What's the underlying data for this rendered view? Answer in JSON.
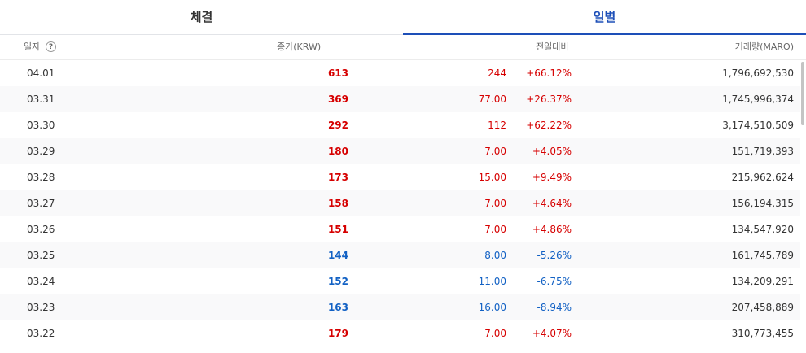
{
  "tabs": [
    {
      "label": "체결"
    },
    {
      "label": "일별"
    }
  ],
  "header": {
    "date": "일자",
    "help": "?",
    "close": "종가(KRW)",
    "change": "전일대비",
    "volume": "거래량(MARO)"
  },
  "colors": {
    "up": "#d60000",
    "down": "#1261c4",
    "accent": "#1d4fb8"
  },
  "rows": [
    {
      "date": "04.01",
      "close": "613",
      "change": "244",
      "pct": "+66.12%",
      "volume": "1,796,692,530",
      "dir": "up"
    },
    {
      "date": "03.31",
      "close": "369",
      "change": "77.00",
      "pct": "+26.37%",
      "volume": "1,745,996,374",
      "dir": "up"
    },
    {
      "date": "03.30",
      "close": "292",
      "change": "112",
      "pct": "+62.22%",
      "volume": "3,174,510,509",
      "dir": "up"
    },
    {
      "date": "03.29",
      "close": "180",
      "change": "7.00",
      "pct": "+4.05%",
      "volume": "151,719,393",
      "dir": "up"
    },
    {
      "date": "03.28",
      "close": "173",
      "change": "15.00",
      "pct": "+9.49%",
      "volume": "215,962,624",
      "dir": "up"
    },
    {
      "date": "03.27",
      "close": "158",
      "change": "7.00",
      "pct": "+4.64%",
      "volume": "156,194,315",
      "dir": "up"
    },
    {
      "date": "03.26",
      "close": "151",
      "change": "7.00",
      "pct": "+4.86%",
      "volume": "134,547,920",
      "dir": "up"
    },
    {
      "date": "03.25",
      "close": "144",
      "change": "8.00",
      "pct": "-5.26%",
      "volume": "161,745,789",
      "dir": "down"
    },
    {
      "date": "03.24",
      "close": "152",
      "change": "11.00",
      "pct": "-6.75%",
      "volume": "134,209,291",
      "dir": "down"
    },
    {
      "date": "03.23",
      "close": "163",
      "change": "16.00",
      "pct": "-8.94%",
      "volume": "207,458,889",
      "dir": "down"
    },
    {
      "date": "03.22",
      "close": "179",
      "change": "7.00",
      "pct": "+4.07%",
      "volume": "310,773,455",
      "dir": "up"
    }
  ]
}
